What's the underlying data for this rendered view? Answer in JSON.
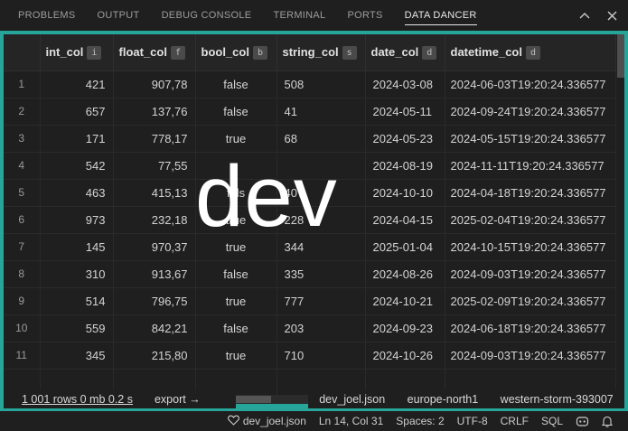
{
  "panel_tabs": [
    "PROBLEMS",
    "OUTPUT",
    "DEBUG CONSOLE",
    "TERMINAL",
    "PORTS",
    "DATA DANCER"
  ],
  "active_tab": "DATA DANCER",
  "columns": [
    {
      "name": "int_col",
      "type": "i"
    },
    {
      "name": "float_col",
      "type": "f"
    },
    {
      "name": "bool_col",
      "type": "b"
    },
    {
      "name": "string_col",
      "type": "s"
    },
    {
      "name": "date_col",
      "type": "d"
    },
    {
      "name": "datetime_col",
      "type": "d"
    }
  ],
  "rows": [
    {
      "idx": "1",
      "int": "421",
      "float": "907,78",
      "bool": "false",
      "str": "508",
      "date": "2024-03-08",
      "dt": "2024-06-03T19:20:24.336577"
    },
    {
      "idx": "2",
      "int": "657",
      "float": "137,76",
      "bool": "false",
      "str": "41",
      "date": "2024-05-11",
      "dt": "2024-09-24T19:20:24.336577"
    },
    {
      "idx": "3",
      "int": "171",
      "float": "778,17",
      "bool": "true",
      "str": "68",
      "date": "2024-05-23",
      "dt": "2024-05-15T19:20:24.336577"
    },
    {
      "idx": "4",
      "int": "542",
      "float": "77,55",
      "bool": "",
      "str": "",
      "date": "2024-08-19",
      "dt": "2024-11-11T19:20:24.336577"
    },
    {
      "idx": "5",
      "int": "463",
      "float": "415,13",
      "bool": "fals",
      "str": "407",
      "date": "2024-10-10",
      "dt": "2024-04-18T19:20:24.336577"
    },
    {
      "idx": "6",
      "int": "973",
      "float": "232,18",
      "bool": "true",
      "str": "228",
      "date": "2024-04-15",
      "dt": "2025-02-04T19:20:24.336577"
    },
    {
      "idx": "7",
      "int": "145",
      "float": "970,37",
      "bool": "true",
      "str": "344",
      "date": "2025-01-04",
      "dt": "2024-10-15T19:20:24.336577"
    },
    {
      "idx": "8",
      "int": "310",
      "float": "913,67",
      "bool": "false",
      "str": "335",
      "date": "2024-08-26",
      "dt": "2024-09-03T19:20:24.336577"
    },
    {
      "idx": "9",
      "int": "514",
      "float": "796,75",
      "bool": "true",
      "str": "777",
      "date": "2024-10-21",
      "dt": "2025-02-09T19:20:24.336577"
    },
    {
      "idx": "10",
      "int": "559",
      "float": "842,21",
      "bool": "false",
      "str": "203",
      "date": "2024-09-23",
      "dt": "2024-06-18T19:20:24.336577"
    },
    {
      "idx": "11",
      "int": "345",
      "float": "215,80",
      "bool": "true",
      "str": "710",
      "date": "2024-10-26",
      "dt": "2024-09-03T19:20:24.336577"
    }
  ],
  "watermark": "dev",
  "info_left": {
    "stats": "1 001 rows 0 mb 0.2 s",
    "export": "export →"
  },
  "info_right": {
    "file": "dev_joel.json",
    "region": "europe-north1",
    "project": "western-storm-393007"
  },
  "statusbar": {
    "file": "dev_joel.json",
    "position": "Ln 14, Col 31",
    "spaces": "Spaces: 2",
    "encoding": "UTF-8",
    "eol": "CRLF",
    "language": "SQL"
  },
  "icons": {
    "chevron_up": "chevron-up-icon",
    "close": "close-icon",
    "heart": "heart-icon",
    "copilot": "copilot-icon",
    "bell": "bell-icon"
  },
  "colors": {
    "accent": "#26a69a",
    "background": "#1f1f1f",
    "header": "#252526"
  }
}
